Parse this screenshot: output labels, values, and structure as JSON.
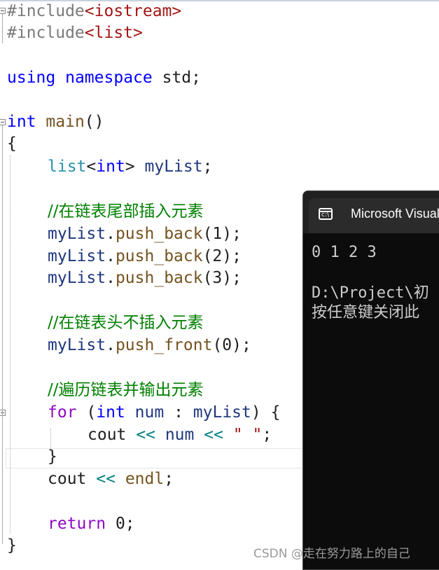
{
  "editor": {
    "line1": {
      "directive": "#include",
      "header": "<iostream>"
    },
    "line2": {
      "directive": "#include",
      "header": "<list>"
    },
    "line4": {
      "kw1": "using",
      "kw2": "namespace",
      "rest": "std;"
    },
    "line6": {
      "kw": "int",
      "fn": "main",
      "paren": "()"
    },
    "line7": {
      "brace": "{"
    },
    "line8": {
      "type": "list",
      "lt": "<",
      "kw": "int",
      "gt": ">",
      "var": "myList",
      "end": ";"
    },
    "line10": {
      "comment": "//在链表尾部插入元素"
    },
    "line11": {
      "obj": "myList",
      "dot": ".",
      "fn": "push_back",
      "args": "(1);"
    },
    "line12": {
      "obj": "myList",
      "dot": ".",
      "fn": "push_back",
      "args": "(2);"
    },
    "line13": {
      "obj": "myList",
      "dot": ".",
      "fn": "push_back",
      "args": "(3);"
    },
    "line15": {
      "comment": "//在链表头不插入元素"
    },
    "line16": {
      "obj": "myList",
      "dot": ".",
      "fn": "push_front",
      "args": "(0);"
    },
    "line18": {
      "comment": "//遍历链表并输出元素"
    },
    "line19": {
      "kw": "for",
      "open": "(",
      "kw2": "int",
      "var": "num",
      "colon": ":",
      "coll": "myList",
      "close": ") {"
    },
    "line20": {
      "obj": "cout",
      "op1": "<<",
      "var": "num",
      "op2": "<<",
      "str": "\" \"",
      "end": ";"
    },
    "line21": {
      "brace": "}"
    },
    "line22": {
      "obj": "cout",
      "op": "<<",
      "fn": "endl",
      "end": ";"
    },
    "line24": {
      "kw": "return",
      "rest": "0;"
    },
    "line25": {
      "brace": "}"
    }
  },
  "console": {
    "title": "Microsoft Visual Studio Debug Console",
    "output": "0 1 2 3",
    "path_line": "D:\\Project\\初",
    "prompt_line": "按任意键关闭此"
  },
  "watermark": "CSDN @走在努力路上的自己",
  "colors": {
    "keyword": "#0000ff",
    "preprocessor": "#7a7a7a",
    "string": "#a31515",
    "type": "#2b91af",
    "function": "#74531f",
    "variable": "#1f377f",
    "comment": "#008000",
    "control": "#8f08c4",
    "operator": "#008080",
    "console_bg": "#0c0c0c"
  }
}
